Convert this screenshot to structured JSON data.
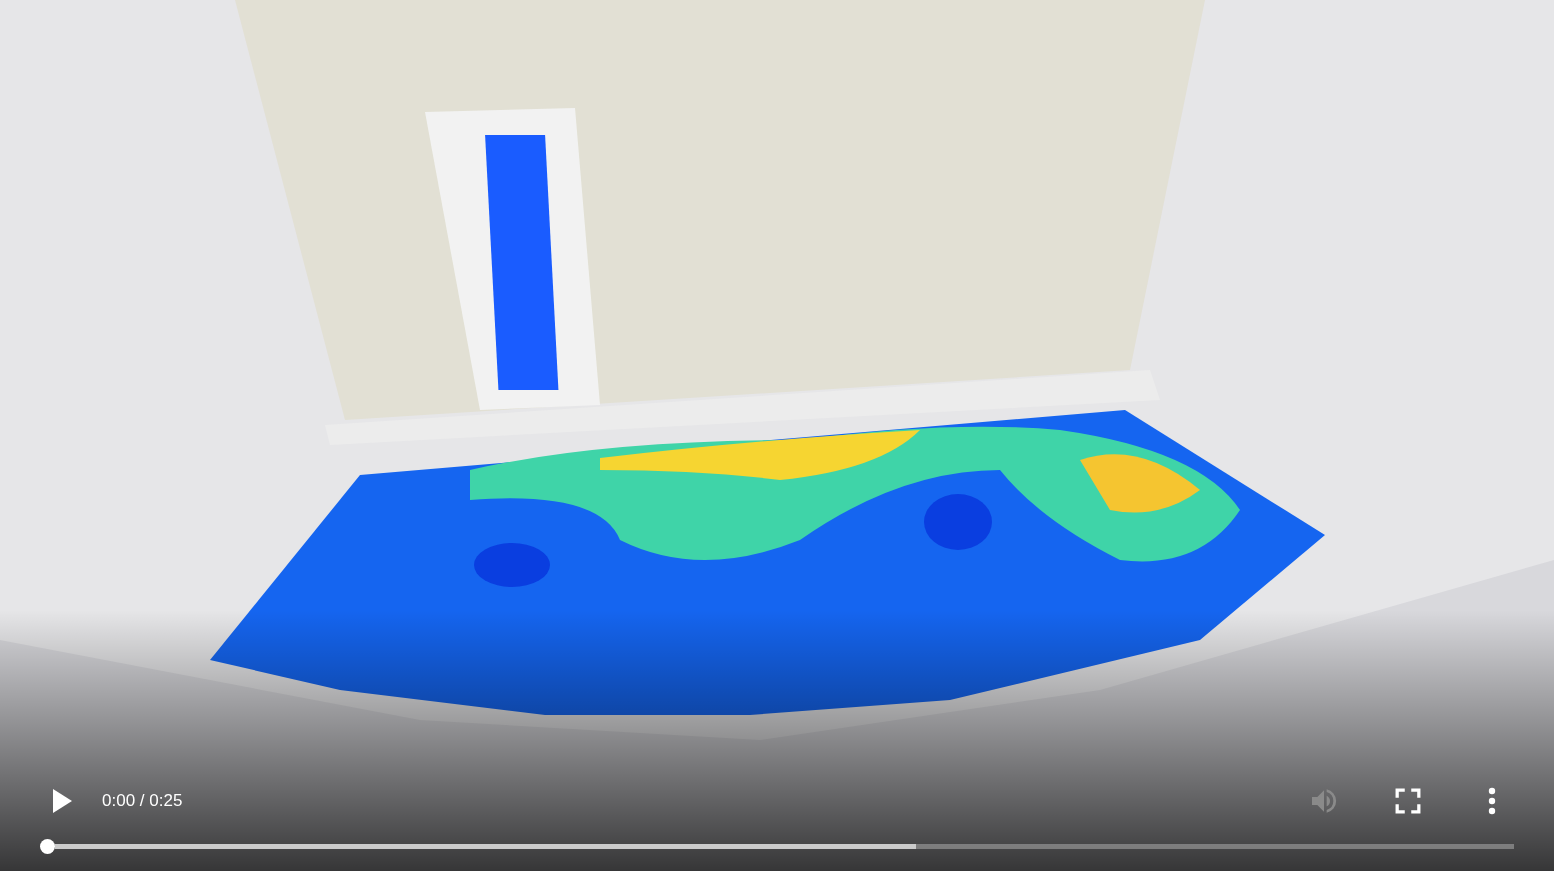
{
  "controls": {
    "play": {
      "playing": false
    },
    "time": "0:00 / 0:25",
    "volume": {
      "disabled": true
    }
  },
  "progress": {
    "level": 0
  },
  "buffer": {
    "level": 0.59
  }
}
